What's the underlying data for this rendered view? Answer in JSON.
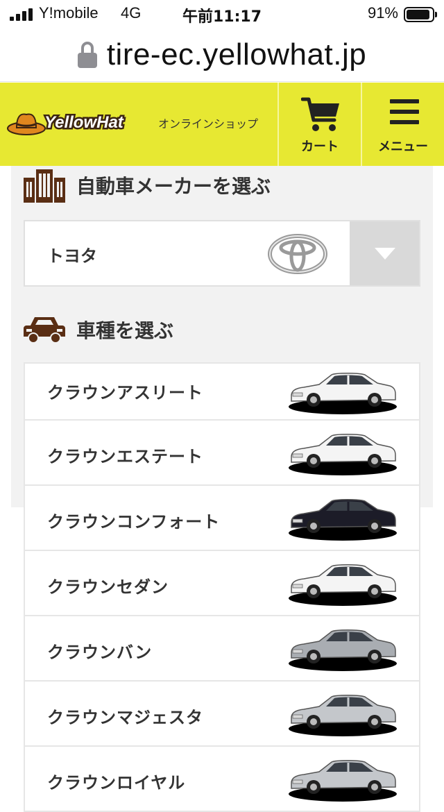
{
  "status_bar": {
    "carrier": "Y!mobile",
    "network": "4G",
    "time": "午前11:17",
    "battery_percent": "91%",
    "battery_level": 0.91
  },
  "browser": {
    "url": "tire-ec.yellowhat.jp"
  },
  "header": {
    "logo_text": "YellowHat",
    "logo_subtitle": "オンラインショップ",
    "cart_label": "カート",
    "menu_label": "メニュー",
    "brand_color": "#e7e832"
  },
  "maker_section": {
    "heading": "自動車メーカーを選ぶ",
    "selected_maker": "トヨタ"
  },
  "model_section": {
    "heading": "車種を選ぶ",
    "models": [
      {
        "name": "クラウンアスリート",
        "car_color": "#f4f4f4"
      },
      {
        "name": "クラウンエステート",
        "car_color": "#f4f4f4"
      },
      {
        "name": "クラウンコンフォート",
        "car_color": "#1c1c28"
      },
      {
        "name": "クラウンセダン",
        "car_color": "#f4f4f4"
      },
      {
        "name": "クラウンバン",
        "car_color": "#a9adb2"
      },
      {
        "name": "クラウンマジェスタ",
        "car_color": "#c4c7cb"
      },
      {
        "name": "クラウンロイヤル",
        "car_color": "#c4c7cb"
      }
    ]
  }
}
